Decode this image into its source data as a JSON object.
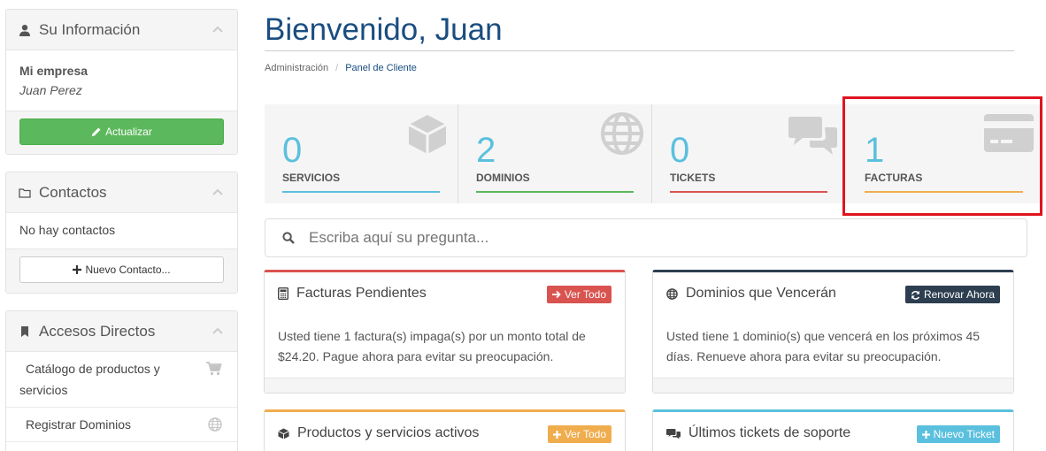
{
  "sidebar": {
    "info": {
      "title": "Su Información",
      "company": "Mi empresa",
      "name": "Juan Perez",
      "update_label": "Actualizar"
    },
    "contacts": {
      "title": "Contactos",
      "empty": "No hay contactos",
      "new_label": "Nuevo Contacto..."
    },
    "shortcuts": {
      "title": "Accesos Directos",
      "items": [
        {
          "label": "Catálogo de productos y servicios",
          "icon": "cart-icon"
        },
        {
          "label": "Registrar Dominios",
          "icon": "globe-icon"
        }
      ]
    }
  },
  "header": {
    "title": "Bienvenido, Juan",
    "breadcrumb": [
      "Administración",
      "Panel de Cliente"
    ],
    "separator": "/"
  },
  "stats": [
    {
      "value": "0",
      "label": "SERVICIOS",
      "color": "#5bc0de",
      "icon": "cube-icon"
    },
    {
      "value": "2",
      "label": "DOMINIOS",
      "color": "#5cb85c",
      "icon": "globe-icon"
    },
    {
      "value": "0",
      "label": "TICKETS",
      "color": "#d9534f",
      "icon": "comments-icon"
    },
    {
      "value": "1",
      "label": "FACTURAS",
      "color": "#f0ad4e",
      "icon": "credit-card-icon"
    }
  ],
  "search": {
    "placeholder": "Escriba aquí su pregunta..."
  },
  "cards": {
    "invoices": {
      "title": "Facturas Pendientes",
      "button": "Ver Todo",
      "body": "Usted tiene 1 factura(s) impaga(s) por un monto total de $24.20. Pague ahora para evitar su preocupación.",
      "color": "#d9534f"
    },
    "domains": {
      "title": "Dominios que Vencerán",
      "button": "Renovar Ahora",
      "body": "Usted tiene 1 dominio(s) que vencerá en los próximos 45 días. Renueve ahora para evitar su preocupación.",
      "color": "#2c3e50"
    },
    "products": {
      "title": "Productos y servicios activos",
      "button": "Ver Todo",
      "color": "#f0ad4e"
    },
    "tickets": {
      "title": "Últimos tickets de soporte",
      "button": "Nuevo Ticket",
      "color": "#5bc0de"
    }
  },
  "colors": {
    "title": "#1a4d80",
    "highlight": "#e0141f"
  }
}
